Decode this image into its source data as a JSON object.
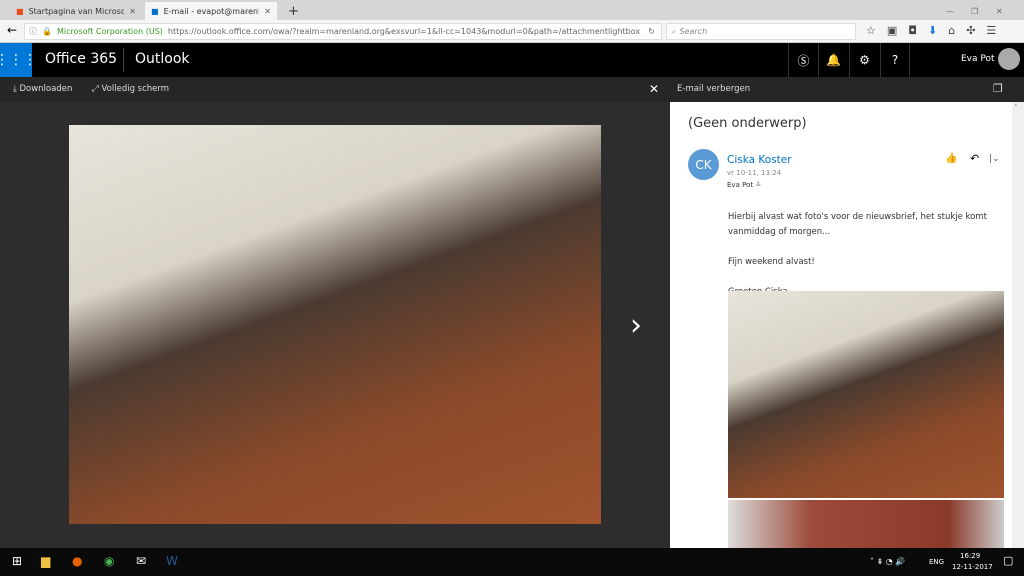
{
  "browser": {
    "tabs": [
      {
        "label": "Startpagina van Microsoft O"
      },
      {
        "label": "E-mail - evapot@marenland"
      }
    ],
    "identity": "Microsoft Corporation (US)",
    "url": "https://outlook.office.com/owa/?realm=marenland.org&exsvurl=1&ll-cc=1043&modurl=0&path=/attachmentlightbox",
    "search_placeholder": "Search"
  },
  "header": {
    "app": "Office 365",
    "module": "Outlook",
    "user": "Eva Pot"
  },
  "toolbar": {
    "download": "Downloaden",
    "fullscreen": "Volledig scherm",
    "hide_email": "E-mail verbergen"
  },
  "email": {
    "subject": "(Geen onderwerp)",
    "initials": "CK",
    "sender": "Ciska Koster",
    "date": "vr 10-11, 13:24",
    "to": "Eva Pot",
    "body": [
      "Hierbij alvast wat foto's voor de nieuwsbrief, het stukje komt vanmiddag of morgen...",
      "Fijn weekend alvast!",
      "Groeten Ciska"
    ],
    "avatar_color": "#5b9bd5",
    "sender_color": "#0072c6"
  },
  "taskbar": {
    "lang": "ENG",
    "time": "16:29",
    "date": "12-11-2017"
  }
}
